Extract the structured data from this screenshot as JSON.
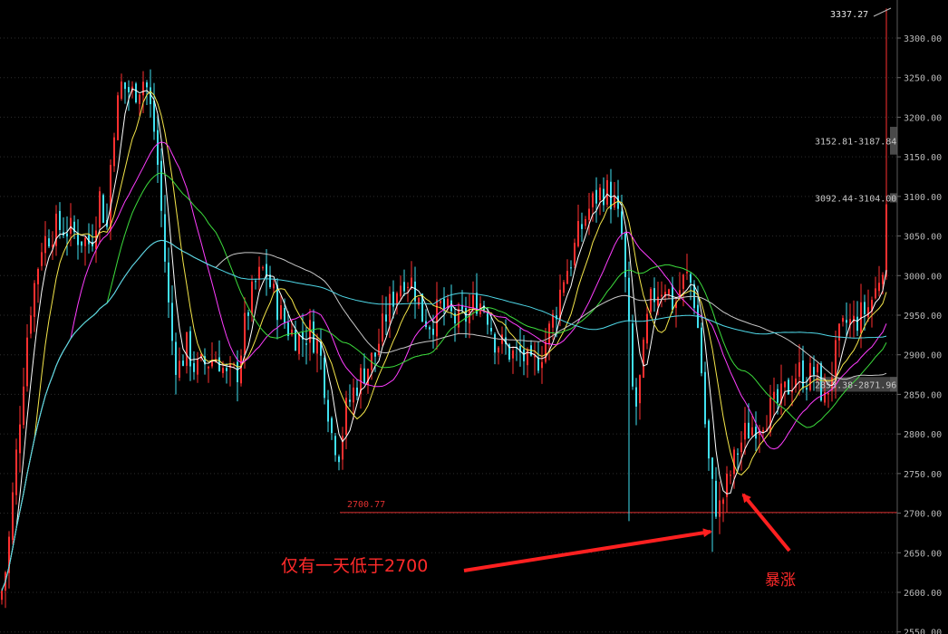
{
  "chart_data": {
    "type": "candlestick",
    "title": "",
    "ylim": [
      2545,
      3340
    ],
    "y_ticks": [
      2550,
      2600,
      2650,
      2700,
      2750,
      2800,
      2850,
      2900,
      2950,
      3000,
      3050,
      3100,
      3150,
      3200,
      3250,
      3300
    ],
    "y_tick_labels": [
      "2550.00",
      "2600.00",
      "2650.00",
      "2700.00",
      "2750.00",
      "2800.00",
      "2850.00",
      "2900.00",
      "2950.00",
      "3000.00",
      "3050.00",
      "3100.00",
      "3150.00",
      "3200.00",
      "3250.00",
      "3300.00"
    ],
    "latest_value_label": "3337.27",
    "level": {
      "value": 2700.77,
      "label": "2700.77"
    },
    "zones": [
      {
        "low": 3152.81,
        "high": 3187.84,
        "label": "3152.81-3187.84"
      },
      {
        "low": 3092.44,
        "high": 3104.0,
        "label": "3092.44-3104.00"
      },
      {
        "low": 2853.38,
        "high": 2871.96,
        "label": "2853.38-2871.96"
      }
    ],
    "anchors": [
      [
        0,
        2590
      ],
      [
        8,
        2640
      ],
      [
        20,
        2800
      ],
      [
        32,
        2950
      ],
      [
        46,
        3040
      ],
      [
        60,
        3060
      ],
      [
        72,
        3060
      ],
      [
        86,
        3050
      ],
      [
        100,
        3040
      ],
      [
        110,
        3100
      ],
      [
        118,
        3060
      ],
      [
        124,
        3180
      ],
      [
        134,
        3240
      ],
      [
        146,
        3230
      ],
      [
        160,
        3250
      ],
      [
        172,
        3170
      ],
      [
        180,
        3050
      ],
      [
        188,
        2930
      ],
      [
        196,
        2880
      ],
      [
        206,
        2910
      ],
      [
        216,
        2880
      ],
      [
        228,
        2890
      ],
      [
        240,
        2900
      ],
      [
        250,
        2870
      ],
      [
        262,
        2880
      ],
      [
        272,
        2950
      ],
      [
        282,
        2990
      ],
      [
        292,
        3010
      ],
      [
        300,
        2980
      ],
      [
        310,
        2950
      ],
      [
        320,
        2930
      ],
      [
        332,
        2920
      ],
      [
        342,
        2930
      ],
      [
        352,
        2910
      ],
      [
        360,
        2850
      ],
      [
        366,
        2800
      ],
      [
        374,
        2780
      ],
      [
        382,
        2830
      ],
      [
        392,
        2860
      ],
      [
        402,
        2880
      ],
      [
        414,
        2900
      ],
      [
        426,
        2950
      ],
      [
        436,
        2980
      ],
      [
        446,
        3000
      ],
      [
        456,
        2990
      ],
      [
        466,
        2950
      ],
      [
        476,
        2940
      ],
      [
        486,
        2960
      ],
      [
        496,
        2950
      ],
      [
        506,
        2940
      ],
      [
        516,
        2950
      ],
      [
        526,
        2970
      ],
      [
        536,
        2960
      ],
      [
        546,
        2920
      ],
      [
        556,
        2910
      ],
      [
        566,
        2900
      ],
      [
        576,
        2900
      ],
      [
        586,
        2880
      ],
      [
        596,
        2900
      ],
      [
        606,
        2930
      ],
      [
        614,
        2960
      ],
      [
        622,
        3000
      ],
      [
        630,
        3020
      ],
      [
        638,
        3050
      ],
      [
        648,
        3080
      ],
      [
        658,
        3100
      ],
      [
        668,
        3110
      ],
      [
        678,
        3090
      ],
      [
        686,
        3050
      ],
      [
        692,
        2960
      ],
      [
        700,
        2820
      ],
      [
        708,
        2880
      ],
      [
        716,
        2960
      ],
      [
        724,
        2980
      ],
      [
        734,
        2990
      ],
      [
        744,
        2960
      ],
      [
        752,
        2990
      ],
      [
        760,
        3000
      ],
      [
        768,
        2960
      ],
      [
        774,
        2880
      ],
      [
        780,
        2780
      ],
      [
        786,
        2730
      ],
      [
        792,
        2700
      ],
      [
        798,
        2720
      ],
      [
        806,
        2750
      ],
      [
        814,
        2780
      ],
      [
        822,
        2800
      ],
      [
        830,
        2810
      ],
      [
        840,
        2820
      ],
      [
        850,
        2830
      ],
      [
        860,
        2840
      ],
      [
        870,
        2860
      ],
      [
        880,
        2880
      ],
      [
        890,
        2870
      ],
      [
        900,
        2880
      ],
      [
        910,
        2840
      ],
      [
        918,
        2880
      ],
      [
        926,
        2920
      ],
      [
        934,
        2940
      ],
      [
        942,
        2940
      ],
      [
        950,
        2950
      ],
      [
        958,
        2960
      ],
      [
        966,
        2980
      ],
      [
        974,
        3020
      ],
      [
        980,
        3090
      ]
    ],
    "spike_low": 2651.0,
    "spike_high": 3337.27,
    "moving_averages": [
      {
        "window": 5,
        "color": "#ffffff"
      },
      {
        "window": 10,
        "color": "#f5e64a"
      },
      {
        "window": 20,
        "color": "#ff3dff"
      },
      {
        "window": 30,
        "color": "#3cdc3c"
      },
      {
        "window": 60,
        "color": "#c8c8c8"
      },
      {
        "window": 120,
        "color": "#4fd8e8"
      }
    ],
    "colors": {
      "up": "#ff3030",
      "down": "#40e0f0",
      "level": "#e03030",
      "zone": "#5a5a5a",
      "annotation": "#ff2020"
    }
  },
  "annotations": {
    "low_note": "仅有一天低于2700",
    "surge_note": "暴涨"
  }
}
